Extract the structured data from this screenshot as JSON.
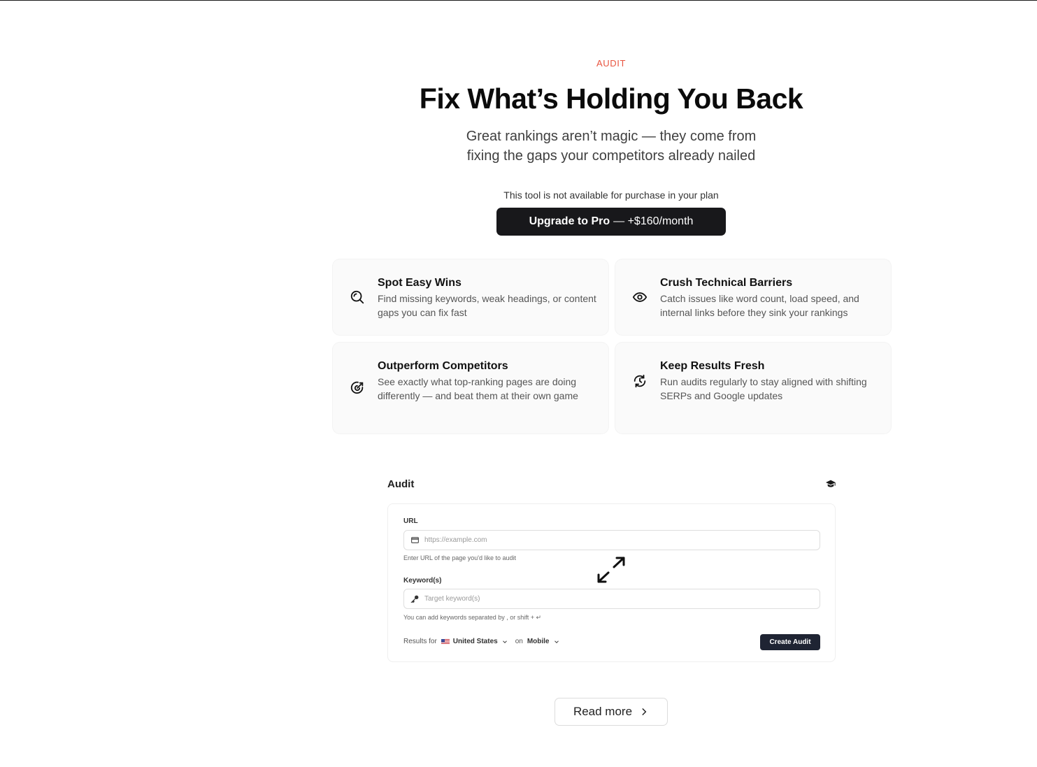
{
  "hero": {
    "eyebrow": "AUDIT",
    "title": "Fix What’s Holding You Back",
    "subtitle_line1": "Great rankings aren’t magic — they come from",
    "subtitle_line2": "fixing the gaps your competitors already nailed",
    "notice": "This tool is not available for purchase in your plan",
    "upgrade_strong": "Upgrade to Pro",
    "upgrade_rest": "— +$160/month"
  },
  "features": [
    {
      "title": "Spot Easy Wins",
      "desc": "Find missing keywords, weak headings, or content gaps you can fix fast",
      "icon": "search-icon"
    },
    {
      "title": "Crush Technical Barriers",
      "desc": "Catch issues like word count, load speed, and internal links before they sink your rankings",
      "icon": "eye-icon"
    },
    {
      "title": "Outperform Competitors",
      "desc": "See exactly what top-ranking pages are doing differently — and beat them at their own game",
      "icon": "target-icon"
    },
    {
      "title": "Keep Results Fresh",
      "desc": "Run audits regularly to stay aligned with shifting SERPs and Google updates",
      "icon": "history-icon"
    }
  ],
  "audit": {
    "title": "Audit",
    "url_label": "URL",
    "url_placeholder": "https://example.com",
    "url_value": "",
    "url_hint": "Enter URL of the page you'd like to audit",
    "kw_label": "Keyword(s)",
    "kw_placeholder": "Target keyword(s)",
    "kw_value": "",
    "kw_hint": "You can add keywords separated by , or shift + ↵",
    "results_for": "Results for",
    "country": "United States",
    "on": "on",
    "device": "Mobile",
    "create_label": "Create Audit"
  },
  "readmore": {
    "label": "Read more"
  },
  "colors": {
    "accent": "#e8543f",
    "button_dark": "#18181b",
    "create_button": "#1f2433"
  }
}
